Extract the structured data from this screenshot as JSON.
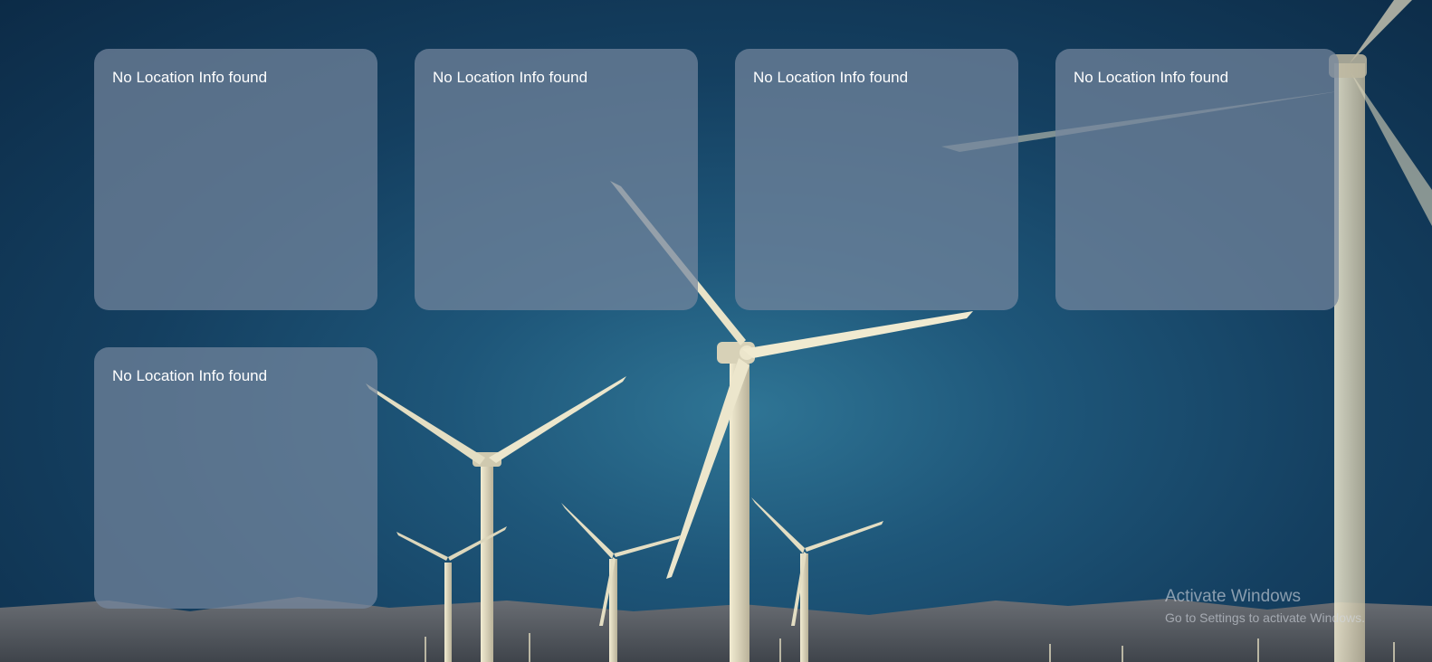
{
  "background": {
    "scene": "wind turbines under blue sky",
    "sky_color": "#1e5679",
    "turbine_color": "#e8e2c6"
  },
  "cards": [
    {
      "message": "No Location Info found"
    },
    {
      "message": "No Location Info found"
    },
    {
      "message": "No Location Info found"
    },
    {
      "message": "No Location Info found"
    },
    {
      "message": "No Location Info found"
    }
  ],
  "watermark": {
    "title": "Activate Windows",
    "subtitle": "Go to Settings to activate Windows."
  }
}
